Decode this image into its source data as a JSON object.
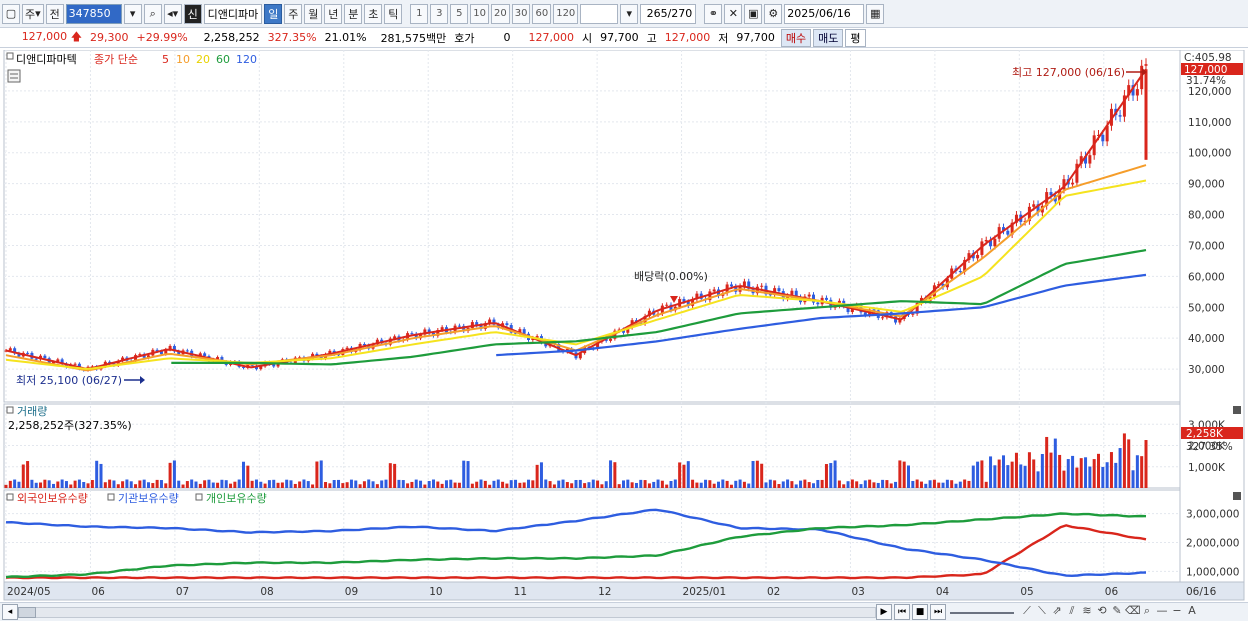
{
  "toolbar": {
    "market": "주",
    "prefix": "전",
    "code": "347850",
    "sin": "신",
    "name": "디앤디파마",
    "periods": [
      "일",
      "주",
      "월",
      "년",
      "분",
      "초",
      "틱"
    ],
    "active_period": "일",
    "intervals": [
      "1",
      "3",
      "5",
      "10",
      "20",
      "30",
      "60",
      "120"
    ],
    "count": "265",
    "count_total": "/270",
    "date": "2025/06/16"
  },
  "quote": {
    "price": "127,000",
    "change": "29,300",
    "change_pct": "+29.99%",
    "volume": "2,258,252",
    "volume_ratio": "327.35%",
    "turnover": "21.01%",
    "amount": "281,575백만",
    "hoga_label": "호가",
    "hoga_value": "0",
    "hoga_price": "127,000",
    "open_label": "시",
    "open": "97,700",
    "high_label": "고",
    "high": "127,000",
    "low_label": "저",
    "low": "97,700",
    "buy_label": "매수",
    "sell_label": "매도",
    "eval_label": "평"
  },
  "price_panel": {
    "legend_name": "디앤디파마텍",
    "legend_type": "종가 단순",
    "ma": [
      "5",
      "10",
      "20",
      "60",
      "120"
    ],
    "ma_colors": [
      "#d9261c",
      "#f59d2a",
      "#f5e31e",
      "#1e9c3c",
      "#2e5de0"
    ],
    "corner_label": "C:405.98",
    "current_badge": "127,000",
    "current_pct": "31.74%",
    "y_ticks": [
      "120,000",
      "110,000",
      "100,000",
      "90,000",
      "80,000",
      "70,000",
      "60,000",
      "50,000",
      "40,000",
      "30,000"
    ],
    "high_annot": "최고 127,000 (06/16)",
    "low_annot": "최저 25,100 (06/27)",
    "dividend_annot": "배당락(0.00%)"
  },
  "volume_panel": {
    "title": "거래량",
    "value_line": "2,258,252주(327.35%)",
    "y_ticks": [
      "3,000K",
      "2,000K",
      "1,000K"
    ],
    "badge": "2,258K",
    "badge_pct": "327.35%"
  },
  "holdings_panel": {
    "legend": [
      {
        "label": "외국인보유수량",
        "color": "#d9261c"
      },
      {
        "label": "기관보유수량",
        "color": "#2e5de0"
      },
      {
        "label": "개인보유수량",
        "color": "#1e9c3c"
      }
    ],
    "y_ticks": [
      "3,000,000",
      "2,000,000",
      "1,000,000"
    ]
  },
  "x_axis": {
    "labels": [
      "2024/05",
      "06",
      "07",
      "08",
      "09",
      "10",
      "11",
      "12",
      "2025/01",
      "02",
      "03",
      "04",
      "05",
      "06"
    ],
    "right_label": "06/16"
  },
  "chart_data": {
    "type": "line",
    "title": "",
    "x": [
      "2024-05",
      "2024-06",
      "2024-07",
      "2024-08",
      "2024-09",
      "2024-10",
      "2024-11",
      "2024-12",
      "2025-01",
      "2025-02",
      "2025-03",
      "2025-04",
      "2025-05",
      "2025-06",
      "2025-06-16"
    ],
    "ylim": [
      20000,
      130000
    ],
    "series": [
      {
        "name": "5",
        "values": [
          36000,
          30000,
          36500,
          30500,
          35000,
          41000,
          45000,
          34500,
          49000,
          57000,
          52000,
          46000,
          70000,
          89000,
          127000
        ]
      },
      {
        "name": "10",
        "values": [
          34500,
          29500,
          35000,
          31500,
          34500,
          40000,
          44000,
          36000,
          47500,
          56000,
          52000,
          47000,
          66000,
          88000,
          96000
        ]
      },
      {
        "name": "20",
        "values": [
          33000,
          30000,
          33500,
          32000,
          33500,
          38000,
          42000,
          38000,
          46000,
          54000,
          52000,
          48500,
          60000,
          86000,
          91000
        ]
      },
      {
        "name": "60",
        "values": [
          null,
          null,
          32000,
          32000,
          31500,
          34000,
          38000,
          39000,
          42000,
          48000,
          50000,
          52000,
          51000,
          64000,
          68500
        ]
      },
      {
        "name": "120",
        "values": [
          null,
          null,
          null,
          null,
          null,
          null,
          34500,
          36000,
          39000,
          43000,
          46500,
          48000,
          50000,
          57000,
          60500
        ]
      }
    ],
    "annotations": {
      "high": {
        "value": 127000,
        "date": "06/16"
      },
      "low": {
        "value": 25100,
        "date": "06/27"
      }
    }
  }
}
